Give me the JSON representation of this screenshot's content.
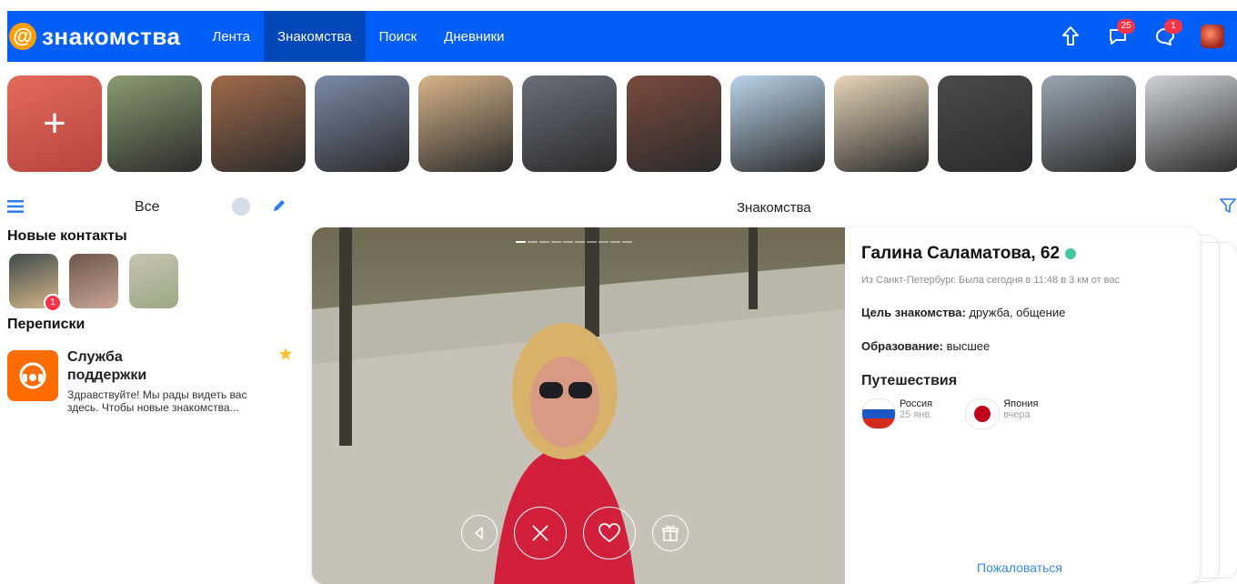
{
  "app": {
    "logo_text": "знакомства",
    "logo_at": "@",
    "nav": [
      {
        "label": "Лента",
        "active": false
      },
      {
        "label": "Знакомства",
        "active": true
      },
      {
        "label": "Поиск",
        "active": false
      },
      {
        "label": "Дневники",
        "active": false
      }
    ],
    "badges": {
      "messages": "25",
      "notifications": "1"
    }
  },
  "stories": {
    "add_symbol": "+",
    "colors": [
      "#8c9c70",
      "#a06a4a",
      "#7b8aa8",
      "#d8b48a",
      "#6a6f7a",
      "#7a4a3e",
      "#b9d4ea",
      "#e7d6b8",
      "#4b4a48",
      "#9aa7b3",
      "#cfd3d8"
    ]
  },
  "left": {
    "filter_label": "Все",
    "new_contacts_title": "Новые контакты",
    "new_contacts_badge": "1",
    "chats_title": "Переписки",
    "support": {
      "name": "Служба поддержки",
      "preview": "Здравствуйте! Мы рады видеть вас здесь. Чтобы новые знакомства..."
    }
  },
  "main": {
    "title": "Знакомства"
  },
  "profile": {
    "name": "Галина Саламатова, 62",
    "subtitle": "Из Санкт-Петербург. Была сегодня в 11:48 в 3 км от вас",
    "goal_label": "Цель знакомства:",
    "goal_value": " дружба, общение",
    "education_label": "Образование:",
    "education_value": " высшее",
    "travel_title": "Путешествия",
    "countries": [
      {
        "name": "Россия",
        "date": "25 янв."
      },
      {
        "name": "Япония",
        "date": "вчера"
      }
    ],
    "report_label": "Пожаловаться"
  },
  "colors": {
    "brand_blue": "#005ff9",
    "nav_active": "#0047ba",
    "online": "#43c59e",
    "badge_red": "#ff3347",
    "link_blue": "#3b8de0",
    "support_orange": "#ff6d00"
  }
}
